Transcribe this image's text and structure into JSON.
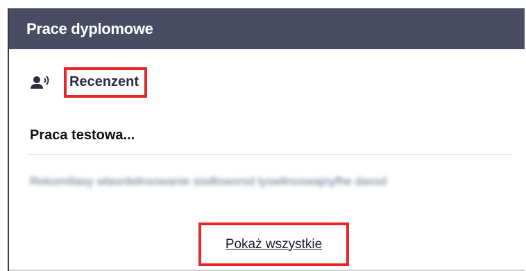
{
  "panel": {
    "title": "Prace dyplomowe",
    "header_color": "#4a4c64"
  },
  "role": {
    "icon": "speaking-person-icon",
    "label": "Recenzent"
  },
  "thesis": {
    "title": "Praca testowa...",
    "blurred_text": "Rekomiliasy wlasnbdnsowanie sisdloworsd lyswlinoswajnyfhe daxsd"
  },
  "actions": {
    "show_all_label": "Pokaż wszystkie"
  },
  "highlight_color": "#e8262a"
}
